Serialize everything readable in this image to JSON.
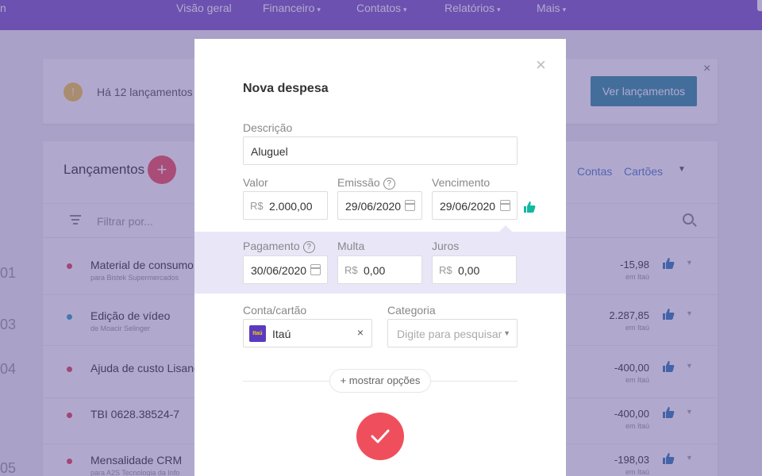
{
  "topnav": {
    "brand": "n",
    "items": [
      {
        "label": "Visão geral",
        "caret": ""
      },
      {
        "label": "Financeiro",
        "caret": "▾"
      },
      {
        "label": "Contatos",
        "caret": "▾"
      },
      {
        "label": "Relatórios",
        "caret": "▾"
      },
      {
        "label": "Mais",
        "caret": "▾"
      }
    ]
  },
  "notice": {
    "badge": "!",
    "text": "Há 12 lançamentos p",
    "button": "Ver lançamentos",
    "close": "×"
  },
  "list": {
    "title": "Lançamentos",
    "add": "+",
    "tab_contas": "Contas",
    "tab_cartoes": "Cartões",
    "filter_placeholder": "Filtrar por...",
    "days": [
      "01",
      "03",
      "04",
      "05"
    ],
    "rows": [
      {
        "title": "Material de consumo",
        "sub": "para Bistek Supermercados",
        "amount": "-15,98",
        "bank": "em Itaú",
        "dot": "#e0445b"
      },
      {
        "title": "Edição de vídeo",
        "sub": "de Moacir Selinger",
        "amount": "2.287,85",
        "bank": "em Itaú",
        "dot": "#2aa3c9"
      },
      {
        "title": "Ajuda de custo Lisand",
        "sub": "",
        "amount": "-400,00",
        "bank": "em Itaú",
        "dot": "#e0445b"
      },
      {
        "title": "TBI 0628.38524-7",
        "sub": "",
        "amount": "-400,00",
        "bank": "em Itaú",
        "dot": "#e0445b"
      },
      {
        "title": "Mensalidade CRM",
        "sub": "para A2S Tecnologia da Info",
        "amount": "-198,03",
        "bank": "em Itaú",
        "dot": "#e0445b"
      }
    ]
  },
  "modal": {
    "title": "Nova despesa",
    "close": "×",
    "descricao_label": "Descrição",
    "descricao_value": "Aluguel",
    "valor_label": "Valor",
    "currency": "R$",
    "valor_value": "2.000,00",
    "emissao_label": "Emissão",
    "emissao_value": "29/06/2020",
    "vencimento_label": "Vencimento",
    "vencimento_value": "29/06/2020",
    "help": "?",
    "pagamento_label": "Pagamento",
    "pagamento_value": "30/06/2020",
    "multa_label": "Multa",
    "multa_value": "0,00",
    "juros_label": "Juros",
    "juros_value": "0,00",
    "conta_label": "Conta/cartão",
    "conta_logo": "Itaú",
    "conta_value": "Itaú",
    "conta_clear": "×",
    "categoria_label": "Categoria",
    "categoria_placeholder": "Digite para pesquisar",
    "more_options": "+ mostrar opções"
  },
  "colors": {
    "nav": "#7b57c8",
    "accent_red": "#ef4f5c",
    "teal": "#2c8fa1",
    "thumb_green": "#10b9a0",
    "thumb_blue": "#2f79b8"
  }
}
